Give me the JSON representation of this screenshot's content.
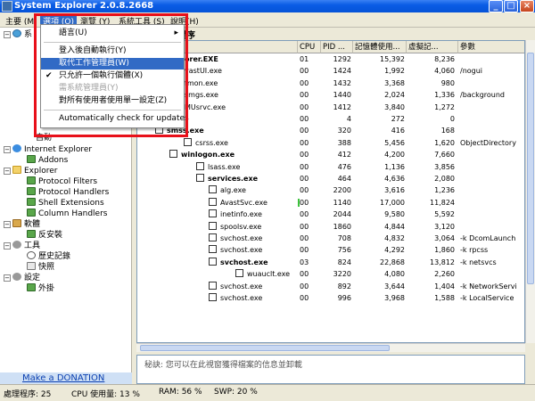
{
  "window": {
    "title": "System Explorer 2.0.8.2668"
  },
  "menubar": [
    {
      "label": "主要 (M)"
    },
    {
      "label": "選項 (O)"
    },
    {
      "label": "瀏覽 (Y)"
    },
    {
      "label": "系統工具 (S)"
    },
    {
      "label": "說明(H)"
    }
  ],
  "dropdown": {
    "items": [
      {
        "label": "語言(U)",
        "arrow": "▸"
      },
      {
        "label": "登入後自動執行(Y)"
      },
      {
        "label": "取代工作管理員(W)"
      },
      {
        "label": "只允許一個執行個體(X)",
        "check": "✔"
      },
      {
        "label": "需系統管理員(Y)"
      },
      {
        "label": "對所有使用者使用單一設定(Z)"
      },
      {
        "label": "Automatically check for updates"
      }
    ]
  },
  "sidebar": {
    "items": [
      {
        "label": "系"
      },
      {
        "label": "自動"
      },
      {
        "label": "Internet Explorer"
      },
      {
        "label": "Addons"
      },
      {
        "label": "Explorer"
      },
      {
        "label": "Protocol Filters"
      },
      {
        "label": "Protocol Handlers"
      },
      {
        "label": "Shell Extensions"
      },
      {
        "label": "Column Handlers"
      },
      {
        "label": "軟體"
      },
      {
        "label": "反安裝"
      },
      {
        "label": "工具"
      },
      {
        "label": "歷史記錄"
      },
      {
        "label": "快照"
      },
      {
        "label": "設定"
      },
      {
        "label": "外掛"
      }
    ],
    "donation": "Make a DONATION"
  },
  "main": {
    "header": "程序",
    "columns": [
      "CPU",
      "PID ...",
      "記憶體使用...",
      "虛擬記...",
      "參數"
    ],
    "rows": [
      {
        "name": "orer.EXE",
        "cpu": "01",
        "pid": "1292",
        "mem": "15,392",
        "vmem": "8,236",
        "args": ""
      },
      {
        "name": "vastUI.exe",
        "cpu": "00",
        "pid": "1424",
        "mem": "1,992",
        "vmem": "4,060",
        "args": "/nogui"
      },
      {
        "name": "fmon.exe",
        "cpu": "00",
        "pid": "1432",
        "mem": "3,368",
        "vmem": "980",
        "args": ""
      },
      {
        "name": "smgs.exe",
        "cpu": "00",
        "pid": "1440",
        "mem": "2,024",
        "vmem": "1,336",
        "args": "/background"
      },
      {
        "name": "MUsrvc.exe",
        "cpu": "00",
        "pid": "1412",
        "mem": "3,840",
        "vmem": "1,272",
        "args": ""
      },
      {
        "name": "en",
        "cpu": "00",
        "pid": "4",
        "mem": "272",
        "vmem": "0",
        "args": ""
      },
      {
        "name": "smss.exe",
        "cpu": "00",
        "pid": "320",
        "mem": "416",
        "vmem": "168",
        "args": ""
      },
      {
        "name": "csrss.exe",
        "cpu": "00",
        "pid": "388",
        "mem": "5,456",
        "vmem": "1,620",
        "args": "ObjectDirectory"
      },
      {
        "name": "winlogon.exe",
        "cpu": "00",
        "pid": "412",
        "mem": "4,200",
        "vmem": "7,660",
        "args": ""
      },
      {
        "name": "lsass.exe",
        "cpu": "00",
        "pid": "476",
        "mem": "1,136",
        "vmem": "3,856",
        "args": ""
      },
      {
        "name": "services.exe",
        "cpu": "00",
        "pid": "464",
        "mem": "4,636",
        "vmem": "2,080",
        "args": ""
      },
      {
        "name": "alg.exe",
        "cpu": "00",
        "pid": "2200",
        "mem": "3,616",
        "vmem": "1,236",
        "args": ""
      },
      {
        "name": "AvastSvc.exe",
        "cpu": "00",
        "pid": "1140",
        "mem": "17,000",
        "vmem": "11,824",
        "args": ""
      },
      {
        "name": "inetinfo.exe",
        "cpu": "00",
        "pid": "2044",
        "mem": "9,580",
        "vmem": "5,592",
        "args": ""
      },
      {
        "name": "spoolsv.exe",
        "cpu": "00",
        "pid": "1860",
        "mem": "4,844",
        "vmem": "3,120",
        "args": ""
      },
      {
        "name": "svchost.exe",
        "cpu": "00",
        "pid": "708",
        "mem": "4,832",
        "vmem": "3,064",
        "args": "-k DcomLaunch"
      },
      {
        "name": "svchost.exe",
        "cpu": "00",
        "pid": "756",
        "mem": "4,292",
        "vmem": "1,860",
        "args": "-k rpcss"
      },
      {
        "name": "svchost.exe",
        "cpu": "03",
        "pid": "824",
        "mem": "22,868",
        "vmem": "13,812",
        "args": "-k netsvcs"
      },
      {
        "name": "wuauclt.exe",
        "cpu": "00",
        "pid": "3220",
        "mem": "4,080",
        "vmem": "2,260",
        "args": ""
      },
      {
        "name": "svchost.exe",
        "cpu": "00",
        "pid": "892",
        "mem": "3,644",
        "vmem": "1,404",
        "args": "-k NetworkServi"
      },
      {
        "name": "svchost.exe",
        "cpu": "00",
        "pid": "996",
        "mem": "3,968",
        "vmem": "1,588",
        "args": "-k LocalService"
      }
    ],
    "description": "秘訣: 您可以在此視窗獲得檔案的信息並卸載"
  },
  "status": {
    "processes": "處理程序: 25",
    "cpu": "CPU 使用量: 13 %",
    "ram": "RAM: 56 %",
    "swp": "SWP: 20 %"
  }
}
